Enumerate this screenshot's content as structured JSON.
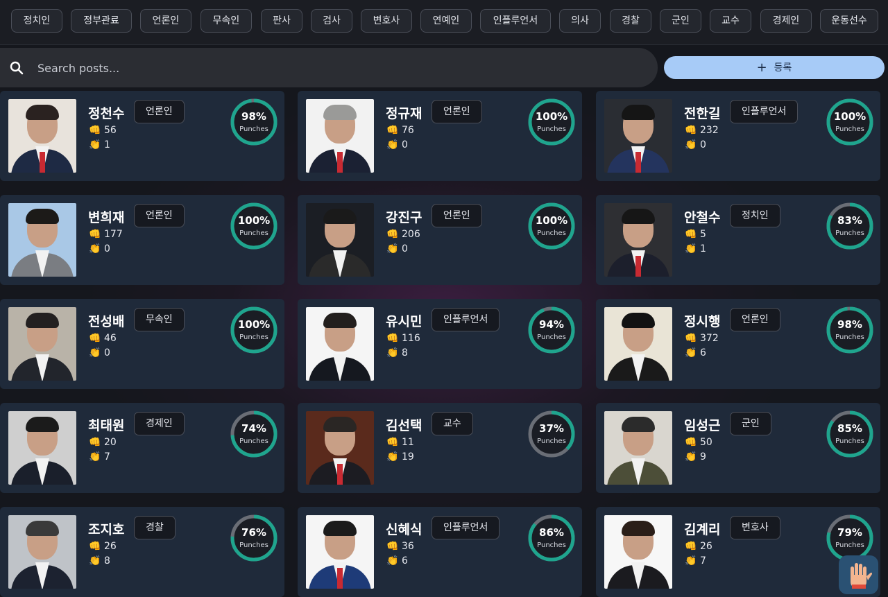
{
  "categories": [
    "정치인",
    "정부관료",
    "언론인",
    "무속인",
    "판사",
    "검사",
    "변호사",
    "연예인",
    "인플루언서",
    "의사",
    "경찰",
    "군인",
    "교수",
    "경제인",
    "운동선수"
  ],
  "search": {
    "placeholder": "Search posts..."
  },
  "add_button": {
    "icon": "plus-icon",
    "label": "등록"
  },
  "stat_label": "Punches",
  "icons": {
    "punch": "👊",
    "clap": "👏",
    "fab": "raised-hand-icon"
  },
  "cards": [
    {
      "name": "정천수",
      "tag": "언론인",
      "punches": "56",
      "claps": "1",
      "percent": "98%",
      "ratio": 0.98
    },
    {
      "name": "정규재",
      "tag": "언론인",
      "punches": "76",
      "claps": "0",
      "percent": "100%",
      "ratio": 1.0
    },
    {
      "name": "전한길",
      "tag": "인플루언서",
      "punches": "232",
      "claps": "0",
      "percent": "100%",
      "ratio": 1.0
    },
    {
      "name": "변희재",
      "tag": "언론인",
      "punches": "177",
      "claps": "0",
      "percent": "100%",
      "ratio": 1.0
    },
    {
      "name": "강진구",
      "tag": "언론인",
      "punches": "206",
      "claps": "0",
      "percent": "100%",
      "ratio": 1.0
    },
    {
      "name": "안철수",
      "tag": "정치인",
      "punches": "5",
      "claps": "1",
      "percent": "83%",
      "ratio": 0.83
    },
    {
      "name": "전성배",
      "tag": "무속인",
      "punches": "46",
      "claps": "0",
      "percent": "100%",
      "ratio": 1.0
    },
    {
      "name": "유시민",
      "tag": "인플루언서",
      "punches": "116",
      "claps": "8",
      "percent": "94%",
      "ratio": 0.94
    },
    {
      "name": "정시행",
      "tag": "언론인",
      "punches": "372",
      "claps": "6",
      "percent": "98%",
      "ratio": 0.98
    },
    {
      "name": "최태원",
      "tag": "경제인",
      "punches": "20",
      "claps": "7",
      "percent": "74%",
      "ratio": 0.74
    },
    {
      "name": "김선택",
      "tag": "교수",
      "punches": "11",
      "claps": "19",
      "percent": "37%",
      "ratio": 0.37
    },
    {
      "name": "임성근",
      "tag": "군인",
      "punches": "50",
      "claps": "9",
      "percent": "85%",
      "ratio": 0.85
    },
    {
      "name": "조지호",
      "tag": "경찰",
      "punches": "26",
      "claps": "8",
      "percent": "76%",
      "ratio": 0.76
    },
    {
      "name": "신혜식",
      "tag": "인플루언서",
      "punches": "36",
      "claps": "6",
      "percent": "86%",
      "ratio": 0.86
    },
    {
      "name": "김계리",
      "tag": "변호사",
      "punches": "26",
      "claps": "7",
      "percent": "79%",
      "ratio": 0.79
    }
  ],
  "colors": {
    "ring_progress": "#1fa58e",
    "ring_track": "#6a6e76",
    "accent_button": "#a7cbf7",
    "card_bg": "#1f2a3a"
  }
}
